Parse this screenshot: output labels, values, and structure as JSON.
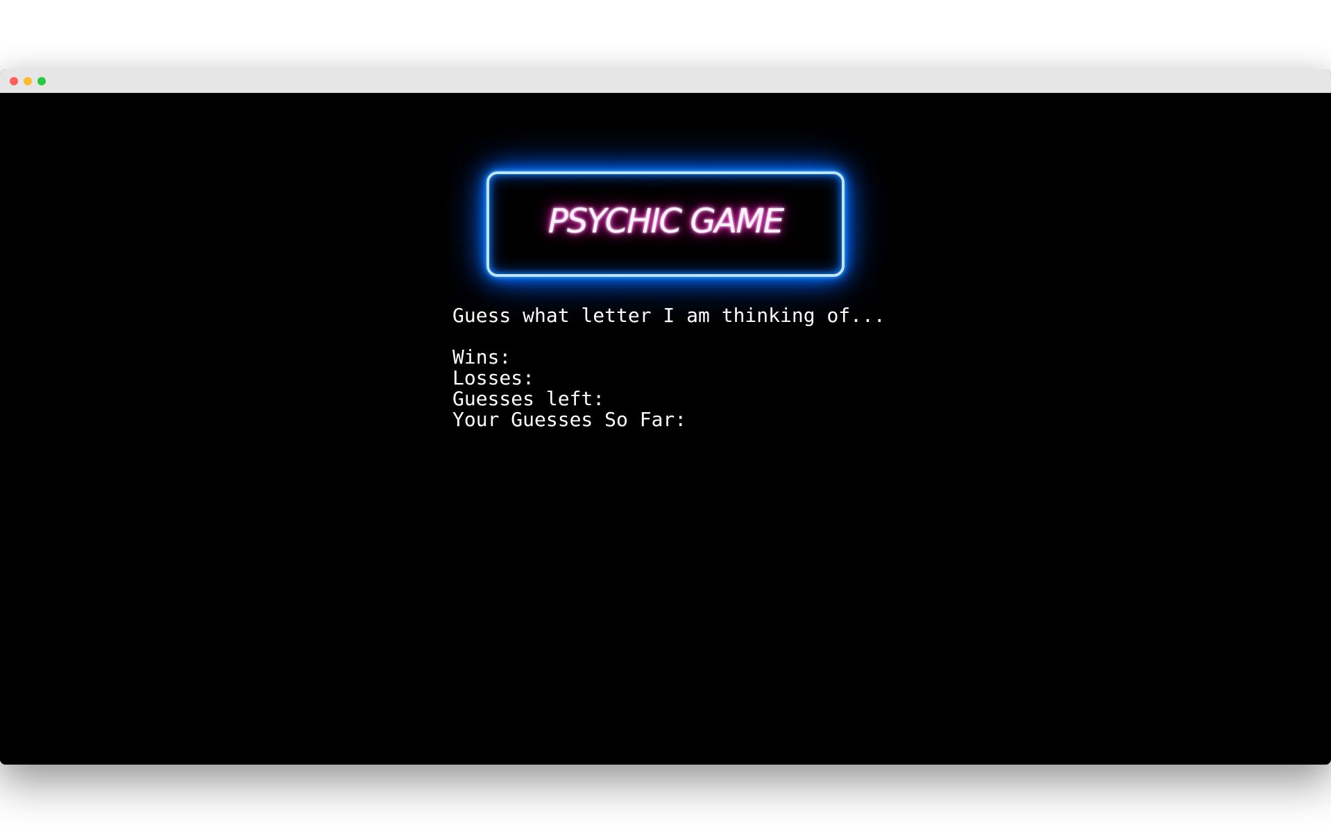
{
  "window": {
    "controls": {
      "close_color": "#ff5f57",
      "minimize_color": "#febc2e",
      "maximize_color": "#28c840"
    }
  },
  "game": {
    "title": "PSYCHIC GAME",
    "prompt": "Guess what letter I am thinking of...",
    "stats": {
      "wins_label": "Wins:",
      "losses_label": "Losses:",
      "guesses_left_label": "Guesses left:",
      "guesses_so_far_label": "Your Guesses So Far:"
    }
  },
  "colors": {
    "background": "#000000",
    "neon_border": "#0a7dff",
    "neon_text_glow": "#e0109a",
    "text": "#ffffff"
  }
}
